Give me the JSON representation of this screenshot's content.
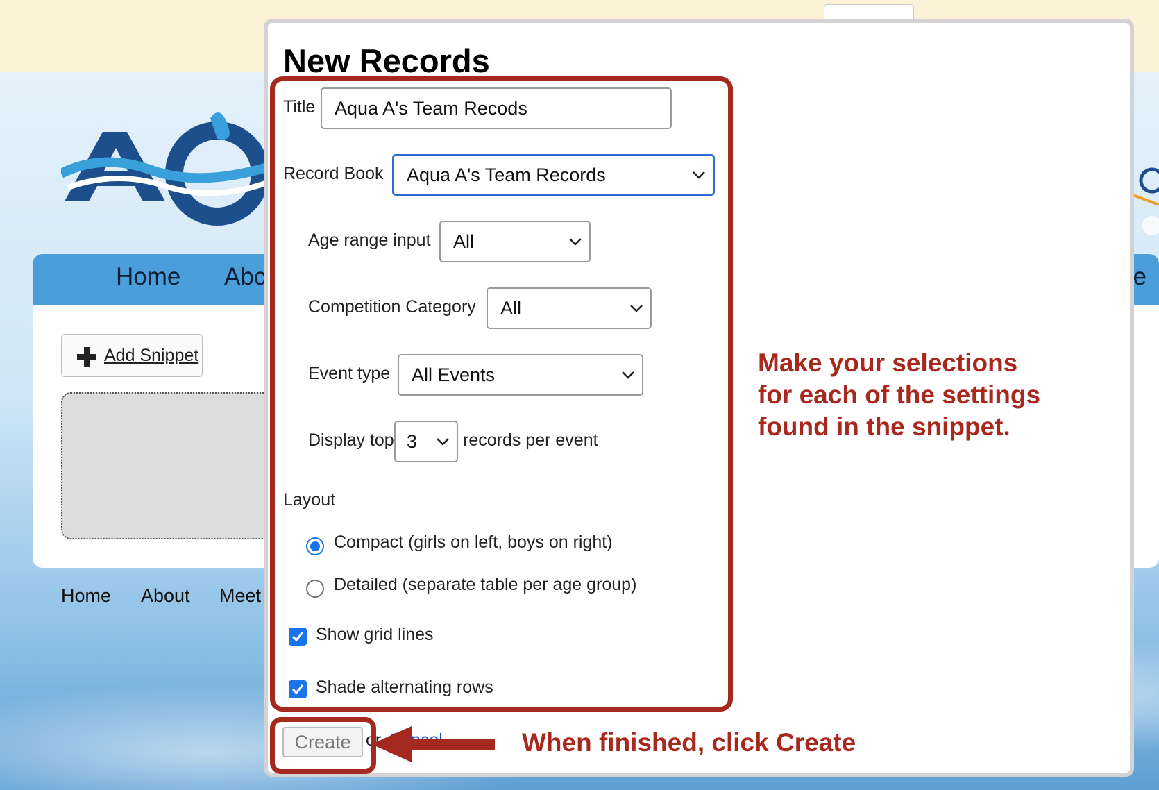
{
  "background": {
    "nav": [
      "Home",
      "Abc",
      "re"
    ],
    "add_snippet_label": "Add Snippet",
    "footer_nav": [
      "Home",
      "About",
      "Meet"
    ]
  },
  "dialog": {
    "title": "New Records",
    "title_label": "Title",
    "title_value": "Aqua A's Team Recods",
    "record_book_label": "Record Book",
    "record_book_value": "Aqua A's Team Records",
    "age_range_label": "Age range input",
    "age_range_value": "All",
    "competition_category_label": "Competition Category",
    "competition_category_value": "All",
    "event_type_label": "Event type",
    "event_type_value": "All Events",
    "display_top_label": "Display top",
    "display_top_value": "3",
    "records_per_event_label": "records per event",
    "layout_label": "Layout",
    "layout_options": [
      {
        "label": "Compact (girls on left, boys on right)",
        "selected": true
      },
      {
        "label": "Detailed (separate table per age group)",
        "selected": false
      }
    ],
    "show_grid_lines_label": "Show grid lines",
    "show_grid_lines_checked": true,
    "shade_rows_label": "Shade alternating rows",
    "shade_rows_checked": true,
    "create_label": "Create",
    "or_text": "or",
    "cancel_label": "Cancel"
  },
  "annotations": {
    "settings_note": [
      "Make your selections",
      "for each of the settings",
      "found in the snippet."
    ],
    "create_note": "When finished, click Create",
    "color": "#a8281e"
  },
  "colors": {
    "accent_blue": "#1a73e8",
    "nav_blue": "#4a9fda",
    "topbar": "#fcf2d8"
  }
}
